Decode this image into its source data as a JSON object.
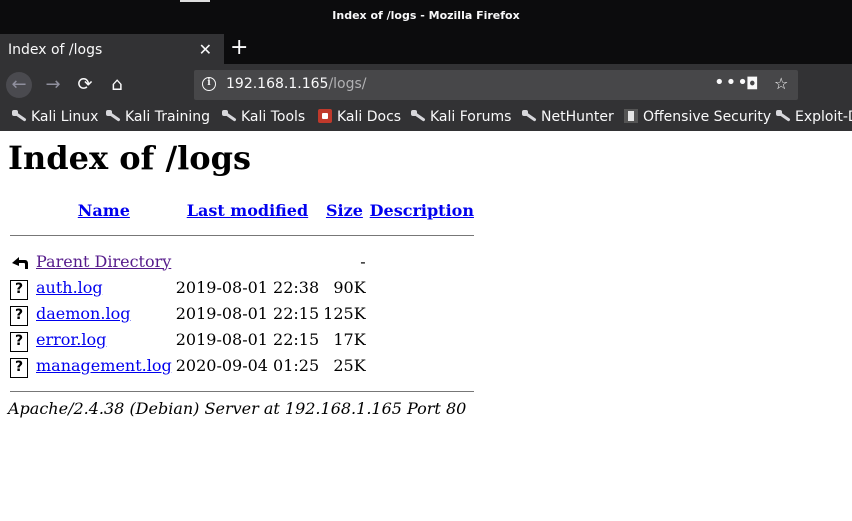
{
  "window": {
    "title": "Index of /logs - Mozilla Firefox"
  },
  "tab": {
    "title": "Index of /logs",
    "close_icon": "close-icon"
  },
  "newtab": {
    "label": "+"
  },
  "nav": {
    "back": "←",
    "forward": "→",
    "reload": "⟳",
    "home": "⌂"
  },
  "urlbar": {
    "host": "192.168.1.165",
    "path": "/logs/",
    "menu": "•••",
    "pocket": "◘",
    "star": "☆"
  },
  "bookmarks": [
    {
      "label": "Kali Linux",
      "icon": "kali-dragon-icon"
    },
    {
      "label": "Kali Training",
      "icon": "kali-dragon-icon"
    },
    {
      "label": "Kali Tools",
      "icon": "kali-dragon-icon"
    },
    {
      "label": "Kali Docs",
      "icon": "kali-docs-icon"
    },
    {
      "label": "Kali Forums",
      "icon": "kali-dragon-icon"
    },
    {
      "label": "NetHunter",
      "icon": "nethunter-icon"
    },
    {
      "label": "Offensive Security",
      "icon": "offsec-icon"
    },
    {
      "label": "Exploit-D",
      "icon": "exploit-db-icon"
    }
  ],
  "page": {
    "heading": "Index of /logs",
    "columns": {
      "name": "Name",
      "modified": "Last modified",
      "size": "Size",
      "description": "Description"
    },
    "parent": {
      "name": "Parent Directory",
      "modified": "",
      "size": "-",
      "description": ""
    },
    "rows": [
      {
        "icon": "?",
        "name": "auth.log",
        "modified": "2019-08-01 22:38",
        "size": "90K",
        "description": ""
      },
      {
        "icon": "?",
        "name": "daemon.log",
        "modified": "2019-08-01 22:15",
        "size": "125K",
        "description": ""
      },
      {
        "icon": "?",
        "name": "error.log",
        "modified": "2019-08-01 22:15",
        "size": "17K",
        "description": ""
      },
      {
        "icon": "?",
        "name": "management.log",
        "modified": "2020-09-04 01:25",
        "size": "25K",
        "description": ""
      }
    ],
    "footer": "Apache/2.4.38 (Debian) Server at 192.168.1.165 Port 80"
  }
}
